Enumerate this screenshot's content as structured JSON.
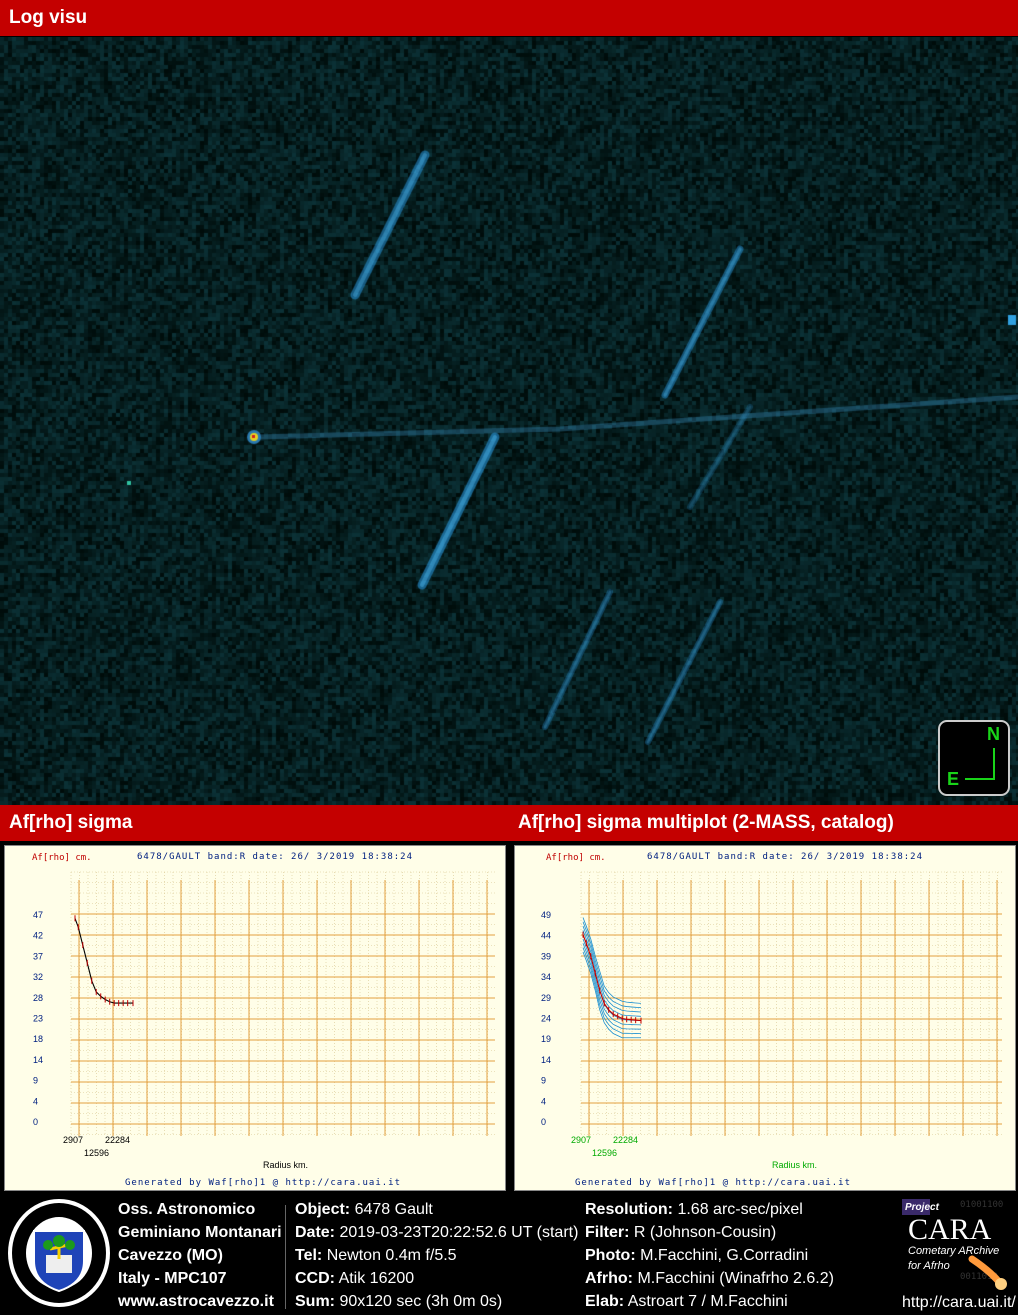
{
  "headers": {
    "top": "Log visu",
    "left": "Af[rho] sigma",
    "right": "Af[rho] sigma multiplot (2-MASS, catalog)"
  },
  "compass": {
    "north": "N",
    "east": "E"
  },
  "plot_left": {
    "ylabel": "Af[rho] cm.",
    "title": "6478/GAULT band:R date: 26/ 3/2019 18:38:24",
    "xlabel": "Radius km.",
    "footer": "Generated by Waf[rho]1 @ http://cara.uai.it",
    "yticks": [
      "47",
      "42",
      "37",
      "32",
      "28",
      "23",
      "18",
      "14",
      "9",
      "4",
      "0"
    ],
    "xticks": [
      "2907",
      "12596",
      "22284"
    ]
  },
  "plot_right": {
    "ylabel": "Af[rho] cm.",
    "title": "6478/GAULT band:R date: 26/ 3/2019 18:38:24",
    "xlabel": "Radius km.",
    "footer": "Generated by Waf[rho]1 @ http://cara.uai.it",
    "yticks": [
      "49",
      "44",
      "39",
      "34",
      "29",
      "24",
      "19",
      "14",
      "9",
      "4",
      "0"
    ],
    "xticks": [
      "2907",
      "12596",
      "22284"
    ]
  },
  "chart_data": [
    {
      "type": "line",
      "title": "6478/GAULT band:R date: 26/ 3/2019 18:38:24",
      "xlabel": "Radius km.",
      "ylabel": "Af[rho] cm.",
      "x": [
        2907,
        4000,
        5500,
        7000,
        8500,
        10000,
        11500,
        13000,
        14500,
        16000,
        17500,
        19000,
        20500,
        22284
      ],
      "series": [
        {
          "values": [
            47,
            45,
            41,
            37,
            33,
            30.5,
            29.5,
            28.8,
            28.3,
            28,
            28,
            28,
            28,
            28
          ]
        }
      ],
      "ylim": [
        0,
        52
      ],
      "grid": true
    },
    {
      "type": "line",
      "title": "6478/GAULT band:R date: 26/ 3/2019 18:38:24",
      "xlabel": "Radius km.",
      "ylabel": "Af[rho] cm.",
      "x": [
        2907,
        4000,
        5500,
        7000,
        8500,
        10000,
        11500,
        13000,
        14500,
        16000,
        17500,
        19000,
        20500,
        22284
      ],
      "series": [
        {
          "values": [
            45,
            43,
            40,
            36,
            32,
            29,
            27.5,
            26.5,
            26,
            25.5,
            25.3,
            25.2,
            25.1,
            25
          ]
        }
      ],
      "envelope": {
        "upper": [
          49,
          47,
          44,
          40,
          36.5,
          33,
          31.5,
          30.5,
          30,
          29.5,
          29.3,
          29.2,
          29.1,
          29
        ],
        "lower": [
          41,
          39,
          36,
          32,
          27.5,
          24.5,
          23,
          22,
          21.5,
          21,
          21,
          21,
          21,
          21
        ]
      },
      "ylim": [
        0,
        54
      ],
      "grid": true
    }
  ],
  "footer": {
    "observatory": [
      "Oss. Astronomico",
      "Geminiano Montanari",
      "Cavezzo (MO)",
      "Italy - MPC107",
      "www.astrocavezzo.it"
    ],
    "emblem_text": "OSSERVATORIO ASTRONOMICO GEMINIANO MONTANARI CAVEZZO MO",
    "col2": [
      {
        "label": "Object:",
        "value": "6478 Gault"
      },
      {
        "label": "Date:",
        "value": "2019-03-23T20:22:52.6 UT (start)"
      },
      {
        "label": "Tel:",
        "value": "Newton 0.4m f/5.5"
      },
      {
        "label": "CCD:",
        "value": "Atik 16200"
      },
      {
        "label": "Sum:",
        "value": "90x120 sec (3h 0m 0s)"
      }
    ],
    "col3": [
      {
        "label": "Resolution:",
        "value": "1.68 arc-sec/pixel"
      },
      {
        "label": "Filter:",
        "value": "R (Johnson-Cousin)"
      },
      {
        "label": "Photo:",
        "value": "M.Facchini, G.Corradini"
      },
      {
        "label": "Afrho:",
        "value": "M.Facchini (Winafrho 2.6.2)"
      },
      {
        "label": "Elab:",
        "value": "Astroart 7 / M.Facchini"
      }
    ],
    "cara": {
      "project": "Project",
      "name": "CARA",
      "line1": "Cometary ARchive",
      "line2": "for Afrho",
      "url": "http://cara.uai.it/"
    }
  }
}
